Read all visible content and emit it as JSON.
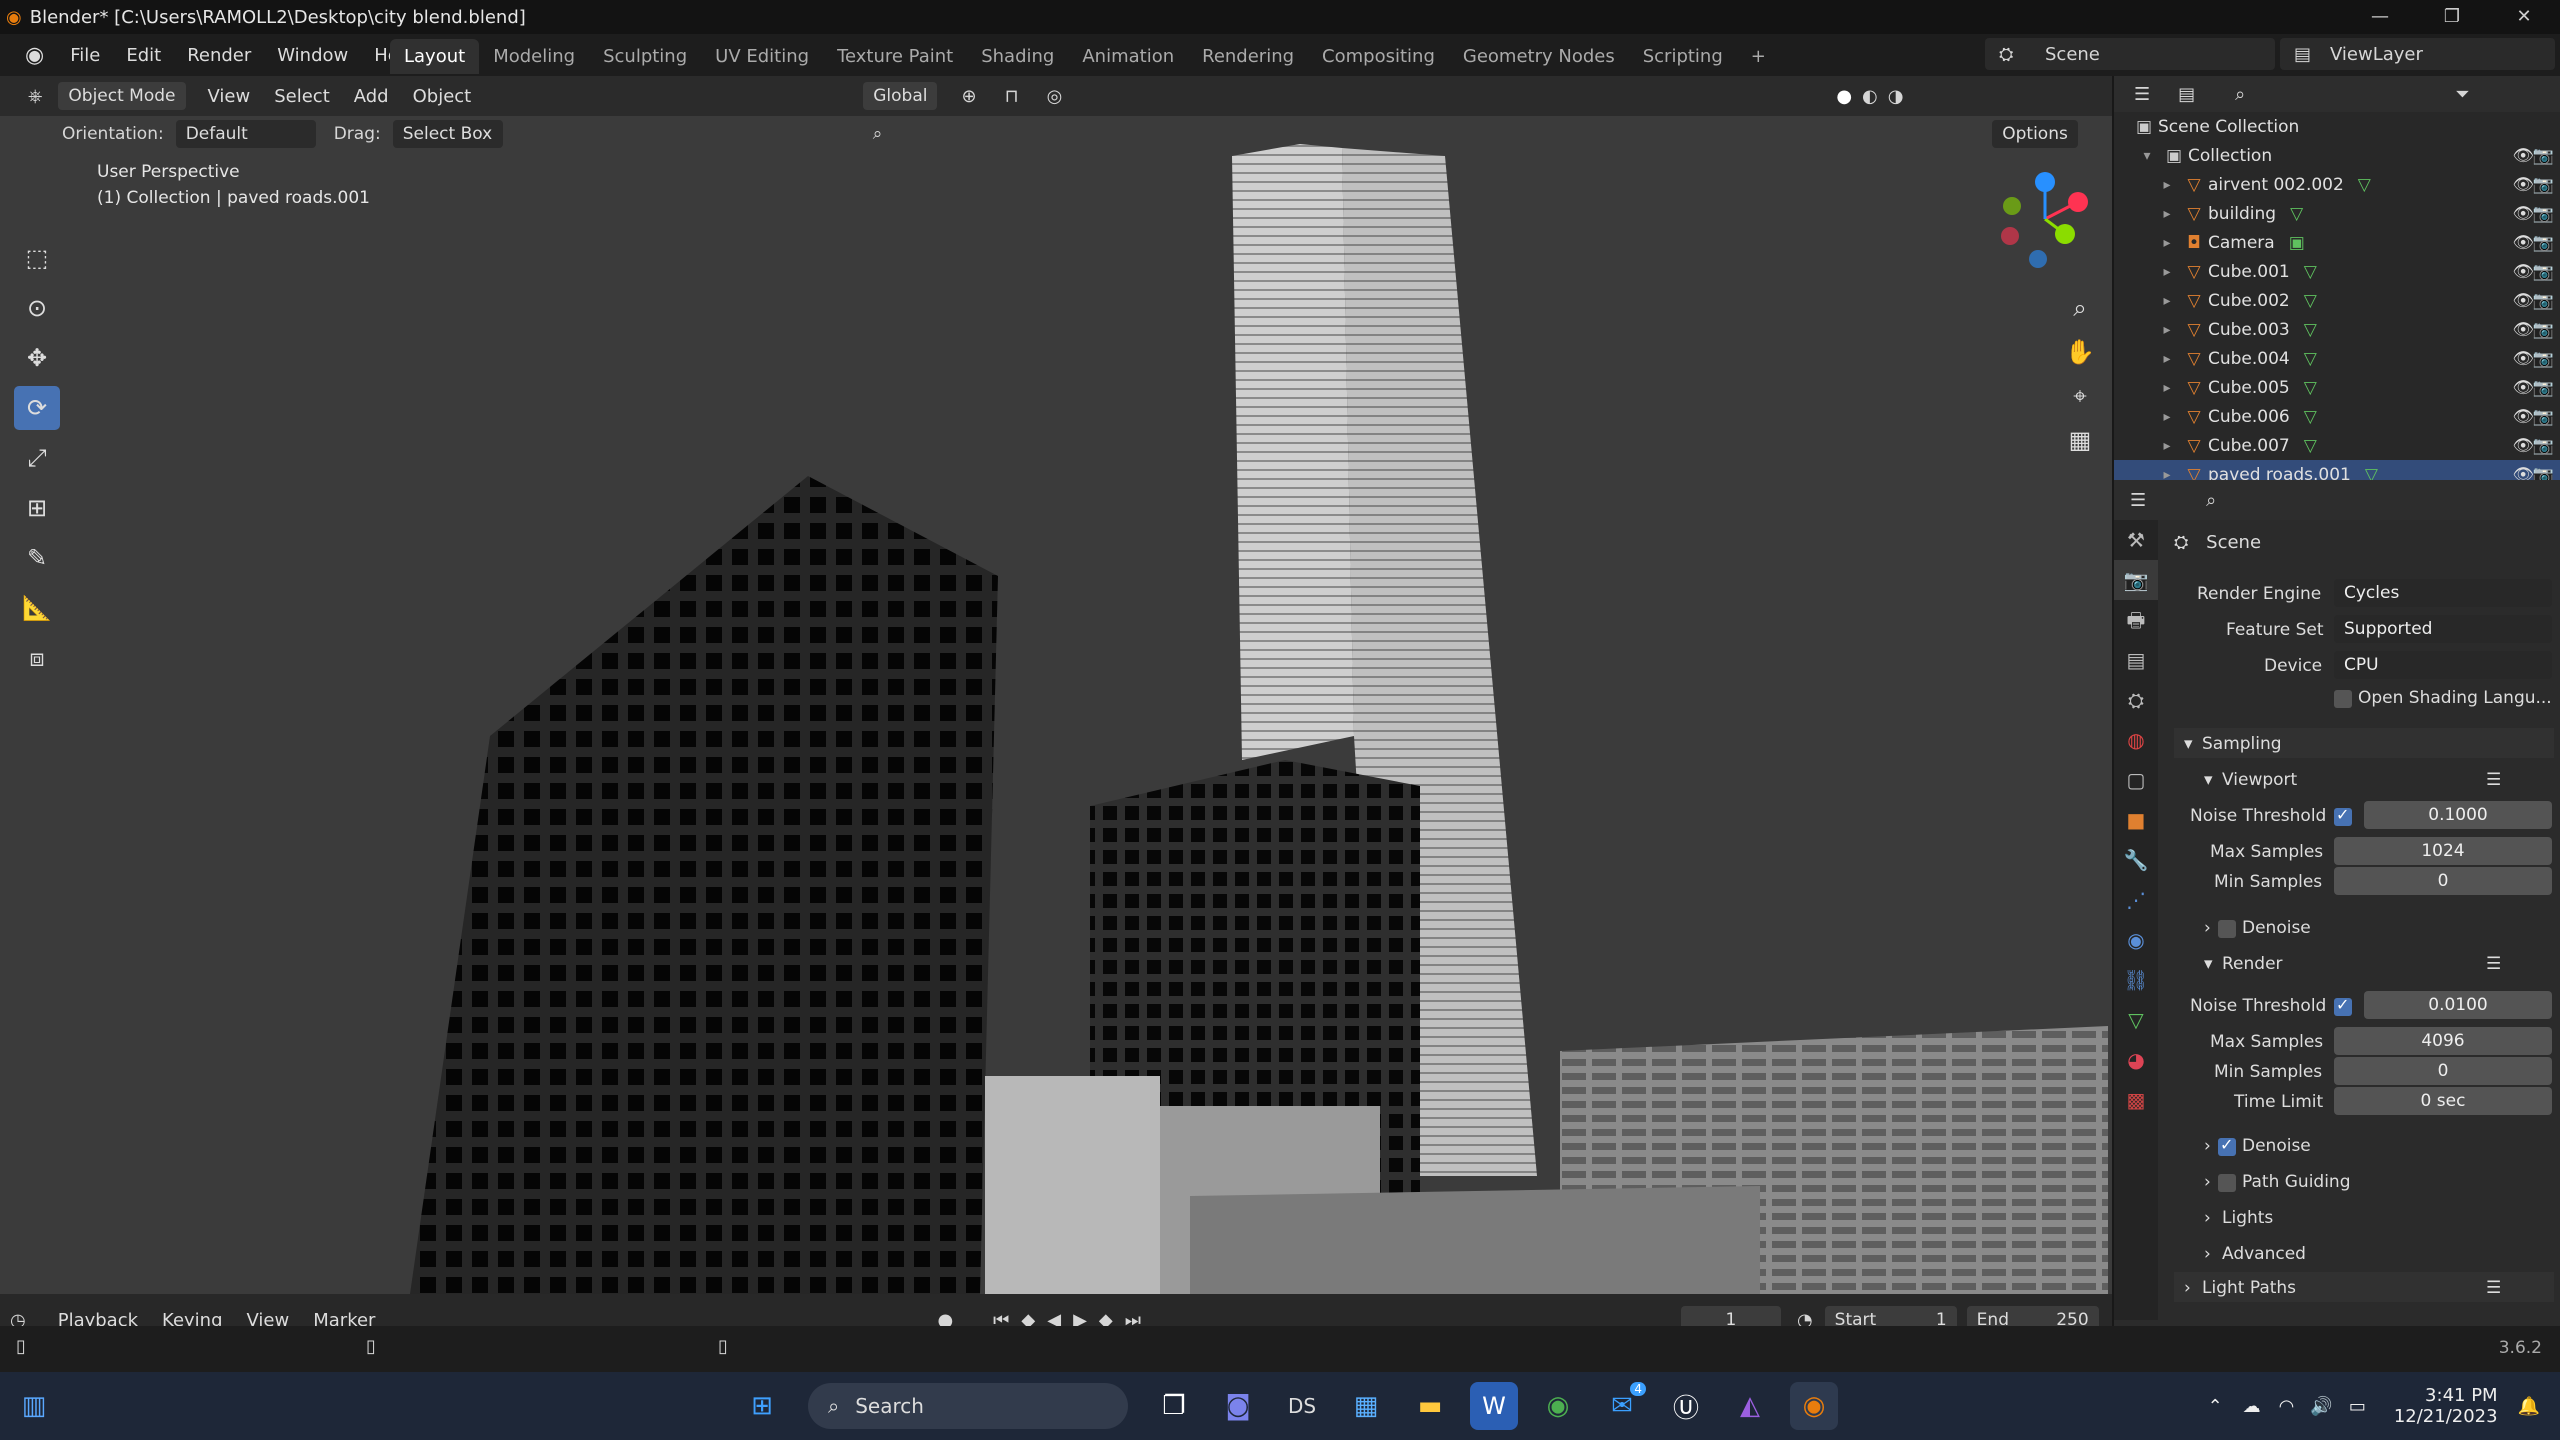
{
  "window": {
    "title": "Blender* [C:\\Users\\RAMOLL2\\Desktop\\city blend.blend]"
  },
  "menu": [
    "File",
    "Edit",
    "Render",
    "Window",
    "Help"
  ],
  "workspaces": [
    "Layout",
    "Modeling",
    "Sculpting",
    "UV Editing",
    "Texture Paint",
    "Shading",
    "Animation",
    "Rendering",
    "Compositing",
    "Geometry Nodes",
    "Scripting"
  ],
  "scene_name": "Scene",
  "view_layer": "ViewLayer",
  "viewport": {
    "mode": "Object Mode",
    "menus": [
      "View",
      "Select",
      "Add",
      "Object"
    ],
    "transform": "Global",
    "orientation_label": "Orientation:",
    "orientation_value": "Default",
    "drag_label": "Drag:",
    "drag_value": "Select Box",
    "options": "Options",
    "perspective": "User Perspective",
    "collection_info": "(1) Collection | paved roads.001"
  },
  "outliner": {
    "scene_collection": "Scene Collection",
    "collection": "Collection",
    "items": [
      "airvent 002.002",
      "building",
      "Camera",
      "Cube.001",
      "Cube.002",
      "Cube.003",
      "Cube.004",
      "Cube.005",
      "Cube.006",
      "Cube.007",
      "paved roads.001"
    ]
  },
  "properties": {
    "header": "Scene",
    "render_engine_label": "Render Engine",
    "render_engine": "Cycles",
    "feature_set_label": "Feature Set",
    "feature_set": "Supported",
    "device_label": "Device",
    "device": "CPU",
    "osl": "Open Shading Langu...",
    "sampling": "Sampling",
    "viewport": "Viewport",
    "noise_threshold_label": "Noise Threshold",
    "vp_noise_threshold": "0.1000",
    "max_samples_label": "Max Samples",
    "vp_max_samples": "1024",
    "min_samples_label": "Min Samples",
    "vp_min_samples": "0",
    "denoise": "Denoise",
    "render": "Render",
    "r_noise_threshold": "0.0100",
    "r_max_samples": "4096",
    "r_min_samples": "0",
    "time_limit_label": "Time Limit",
    "time_limit": "0 sec",
    "path_guiding": "Path Guiding",
    "lights": "Lights",
    "advanced": "Advanced",
    "light_paths": "Light Paths"
  },
  "timeline": {
    "menus": [
      "Playback",
      "Keying",
      "View",
      "Marker"
    ],
    "current_frame": "1",
    "start_label": "Start",
    "start": "1",
    "end_label": "End",
    "end": "250"
  },
  "version": "3.6.2",
  "taskbar": {
    "search": "Search",
    "time": "3:41 PM",
    "date": "12/21/2023",
    "mail_badge": "4"
  },
  "colors": {
    "accent": "#4772b3",
    "object_icon": "#e08030",
    "mesh_icon": "#5fc15f"
  }
}
